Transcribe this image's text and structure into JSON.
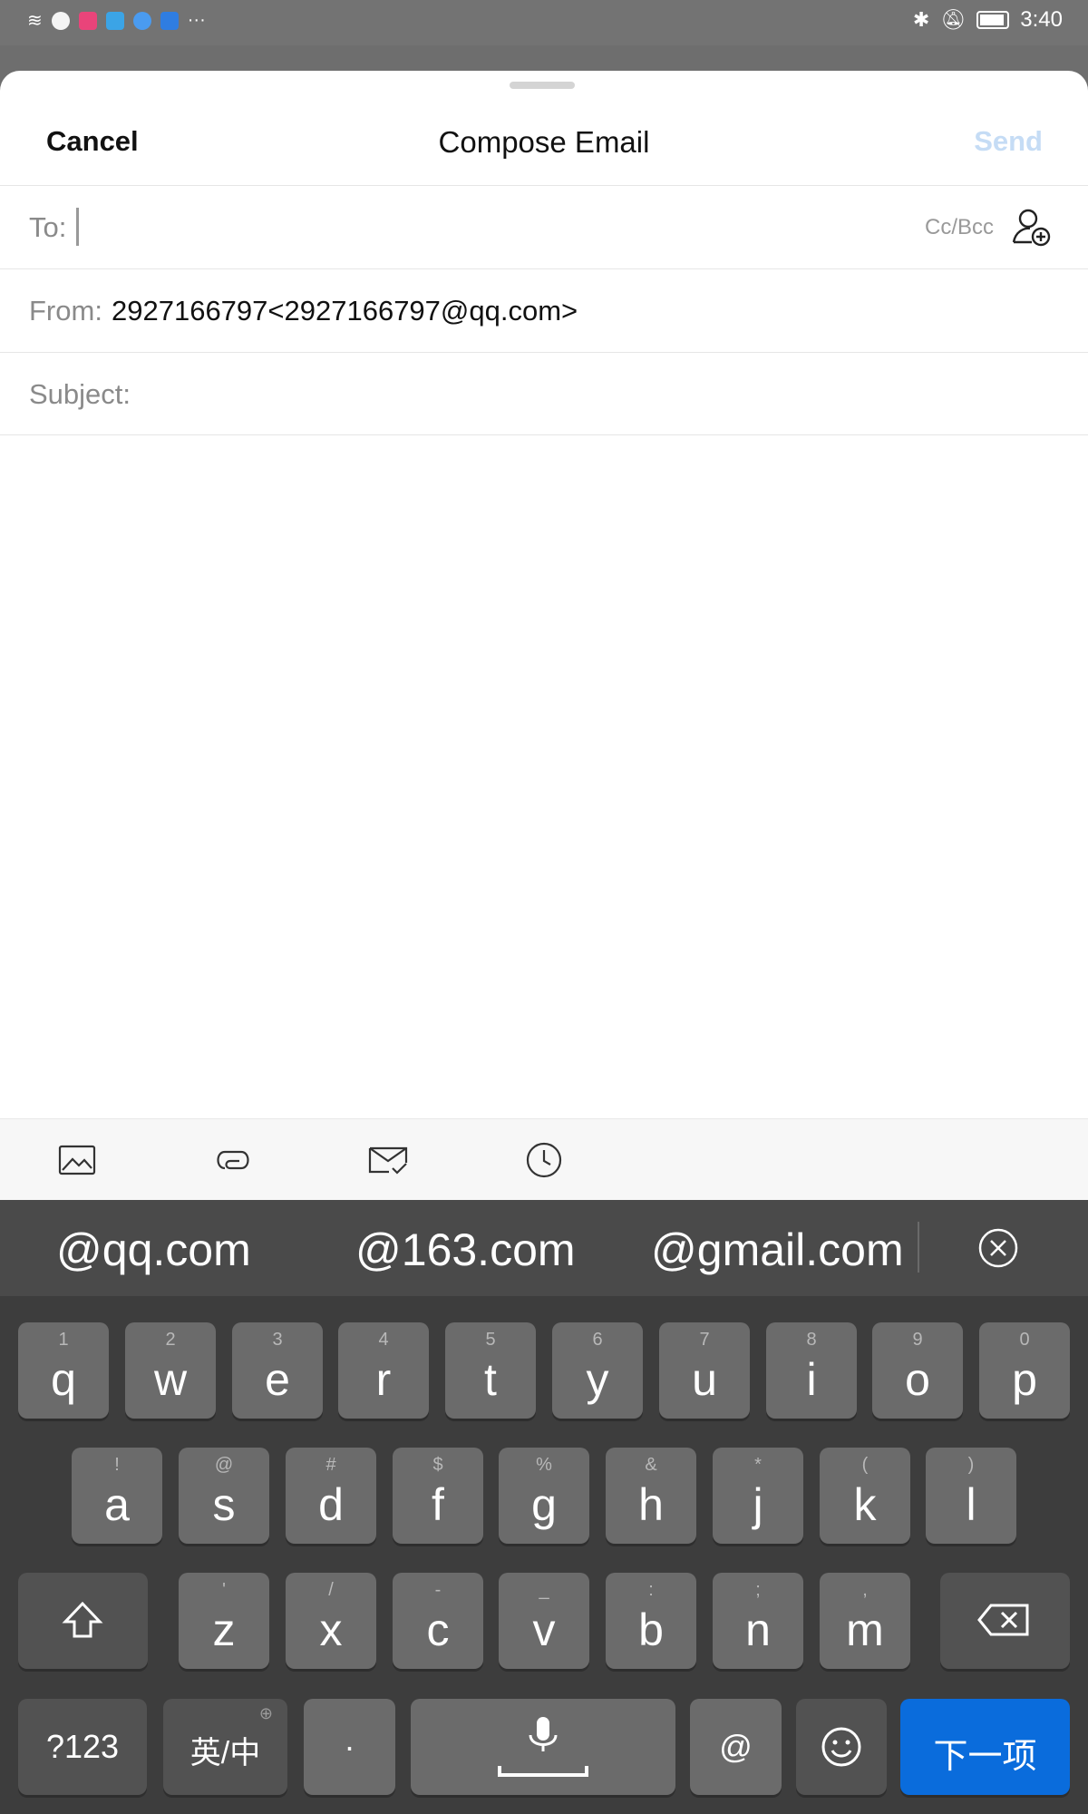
{
  "status": {
    "time": "3:40"
  },
  "nav": {
    "cancel": "Cancel",
    "title": "Compose Email",
    "send": "Send"
  },
  "to": {
    "label": "To:",
    "ccbcc": "Cc/Bcc"
  },
  "from": {
    "label": "From:",
    "value": "2927166797<2927166797@qq.com>"
  },
  "subject": {
    "label": "Subject:"
  },
  "suggestions": [
    "@qq.com",
    "@163.com",
    "@gmail.com"
  ],
  "keys": {
    "row1": [
      {
        "main": "q",
        "hint": "1"
      },
      {
        "main": "w",
        "hint": "2"
      },
      {
        "main": "e",
        "hint": "3"
      },
      {
        "main": "r",
        "hint": "4"
      },
      {
        "main": "t",
        "hint": "5"
      },
      {
        "main": "y",
        "hint": "6"
      },
      {
        "main": "u",
        "hint": "7"
      },
      {
        "main": "i",
        "hint": "8"
      },
      {
        "main": "o",
        "hint": "9"
      },
      {
        "main": "p",
        "hint": "0"
      }
    ],
    "row2": [
      {
        "main": "a",
        "hint": "!"
      },
      {
        "main": "s",
        "hint": "@"
      },
      {
        "main": "d",
        "hint": "#"
      },
      {
        "main": "f",
        "hint": "$"
      },
      {
        "main": "g",
        "hint": "%"
      },
      {
        "main": "h",
        "hint": "&"
      },
      {
        "main": "j",
        "hint": "*"
      },
      {
        "main": "k",
        "hint": "("
      },
      {
        "main": "l",
        "hint": ")"
      }
    ],
    "row3": [
      {
        "main": "z",
        "hint": "'"
      },
      {
        "main": "x",
        "hint": "/"
      },
      {
        "main": "c",
        "hint": "-"
      },
      {
        "main": "v",
        "hint": "_"
      },
      {
        "main": "b",
        "hint": ":"
      },
      {
        "main": "n",
        "hint": ";"
      },
      {
        "main": "m",
        "hint": ","
      }
    ],
    "sym": "?123",
    "lang": "英/中",
    "dot": "·",
    "at": "@",
    "next": "下一项"
  },
  "colors": {
    "accent": "#0a6cdc",
    "send_disabled": "#c5dcf5"
  }
}
